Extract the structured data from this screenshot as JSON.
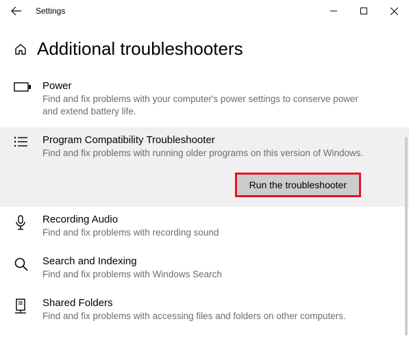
{
  "titlebar": {
    "title": "Settings"
  },
  "page": {
    "title": "Additional troubleshooters"
  },
  "items": [
    {
      "name": "Power",
      "desc": "Find and fix problems with your computer's power settings to conserve power and extend battery life."
    },
    {
      "name": "Program Compatibility Troubleshooter",
      "desc": "Find and fix problems with running older programs on this version of Windows.",
      "run_label": "Run the troubleshooter"
    },
    {
      "name": "Recording Audio",
      "desc": "Find and fix problems with recording sound"
    },
    {
      "name": "Search and Indexing",
      "desc": "Find and fix problems with Windows Search"
    },
    {
      "name": "Shared Folders",
      "desc": "Find and fix problems with accessing files and folders on other computers."
    }
  ]
}
